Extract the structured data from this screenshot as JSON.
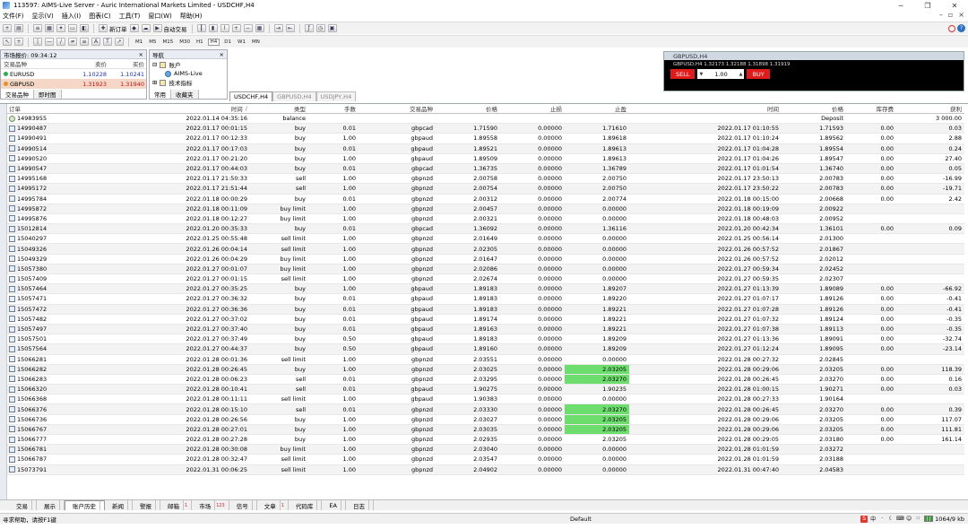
{
  "window": {
    "title": "113597: AIMS-Live Server - Auric International Markets Limited - USDCHF,H4"
  },
  "menu": [
    "文件(F)",
    "显示(V)",
    "插入(I)",
    "图表(C)",
    "工具(T)",
    "窗口(W)",
    "帮助(H)"
  ],
  "toolbar": {
    "new_order": "新订单",
    "auto_trading": "自动交易",
    "timeframes": [
      "M1",
      "M5",
      "M15",
      "M30",
      "H1",
      "H4",
      "D1",
      "W1",
      "MN"
    ]
  },
  "market_watch": {
    "title": "市场报价: 09:34:12",
    "headers": {
      "symbol": "交易品种",
      "bid": "卖价",
      "ask": "买价"
    },
    "rows": [
      {
        "symbol": "EURUSD",
        "bid": "1.10228",
        "ask": "1.10241",
        "color": "#1a2fcf"
      },
      {
        "symbol": "GBPUSD",
        "bid": "1.31923",
        "ask": "1.31940",
        "color": "#cc1010"
      }
    ],
    "tabs": [
      "交易品种",
      "即时图"
    ]
  },
  "navigator": {
    "title": "导航",
    "items": [
      "账户",
      "AIMS-Live",
      "技术指标"
    ],
    "tabs": [
      "常用",
      "收藏夹"
    ]
  },
  "chart_window": {
    "title": "GBPUSD,H4",
    "info": "GBPUSD,H4  1.32173 1.32188 1.31898 1.31919",
    "sell": "SELL",
    "buy": "BUY",
    "lot": "1.00"
  },
  "chart_tabs": [
    "USDCHF,H4",
    "GBPUSD,H4",
    "USDJPY,H4"
  ],
  "history": {
    "headers": {
      "order": "订单",
      "time": "时间",
      "type": "类型",
      "size": "手数",
      "symbol": "交易品种",
      "price": "价格",
      "sl": "止损",
      "tp": "止盈",
      "ctime": "时间",
      "cprice": "价格",
      "swap": "库存费",
      "profit": "获利"
    },
    "rows": [
      {
        "order": "14983955",
        "time": "2022.01.14 04:35:16",
        "type": "balance",
        "size": "",
        "symbol": "",
        "price": "",
        "sl": "",
        "tp": "",
        "ctime": "",
        "cprice": "Deposit",
        "swap": "",
        "profit": "3 000.00",
        "tp_hit": false,
        "balance": true
      },
      {
        "order": "14990487",
        "time": "2022.01.17 00:01:15",
        "type": "buy",
        "size": "0.01",
        "symbol": "gbpcad",
        "price": "1.71590",
        "sl": "0.00000",
        "tp": "1.71610",
        "ctime": "2022.01.17 01:10:55",
        "cprice": "1.71593",
        "swap": "0.00",
        "profit": "0.03",
        "tp_hit": false
      },
      {
        "order": "14990491",
        "time": "2022.01.17 00:12:33",
        "type": "buy",
        "size": "1.00",
        "symbol": "gbpaud",
        "price": "1.89558",
        "sl": "0.00000",
        "tp": "1.89618",
        "ctime": "2022.01.17 01:10:24",
        "cprice": "1.89562",
        "swap": "0.00",
        "profit": "2.88",
        "tp_hit": false
      },
      {
        "order": "14990514",
        "time": "2022.01.17 00:17:03",
        "type": "buy",
        "size": "0.01",
        "symbol": "gbpaud",
        "price": "1.89521",
        "sl": "0.00000",
        "tp": "1.89613",
        "ctime": "2022.01.17 01:04:28",
        "cprice": "1.89554",
        "swap": "0.00",
        "profit": "0.24",
        "tp_hit": false
      },
      {
        "order": "14990520",
        "time": "2022.01.17 00:21:20",
        "type": "buy",
        "size": "1.00",
        "symbol": "gbpaud",
        "price": "1.89509",
        "sl": "0.00000",
        "tp": "1.89613",
        "ctime": "2022.01.17 01:04:26",
        "cprice": "1.89547",
        "swap": "0.00",
        "profit": "27.40",
        "tp_hit": false
      },
      {
        "order": "14990547",
        "time": "2022.01.17 00:44:03",
        "type": "buy",
        "size": "0.01",
        "symbol": "gbpcad",
        "price": "1.36735",
        "sl": "0.00000",
        "tp": "1.36789",
        "ctime": "2022.01.17 01:01:54",
        "cprice": "1.36740",
        "swap": "0.00",
        "profit": "0.05",
        "tp_hit": false
      },
      {
        "order": "14995168",
        "time": "2022.01.17 21:50:33",
        "type": "sell",
        "size": "1.00",
        "symbol": "gbpnzd",
        "price": "2.00758",
        "sl": "0.00000",
        "tp": "2.00750",
        "ctime": "2022.01.17 23:50:13",
        "cprice": "2.00783",
        "swap": "0.00",
        "profit": "-16.99",
        "tp_hit": false
      },
      {
        "order": "14995172",
        "time": "2022.01.17 21:51:44",
        "type": "sell",
        "size": "1.00",
        "symbol": "gbpnzd",
        "price": "2.00754",
        "sl": "0.00000",
        "tp": "2.00750",
        "ctime": "2022.01.17 23:50:22",
        "cprice": "2.00783",
        "swap": "0.00",
        "profit": "-19.71",
        "tp_hit": false
      },
      {
        "order": "14995784",
        "time": "2022.01.18 00:00:29",
        "type": "buy",
        "size": "0.01",
        "symbol": "gbpnzd",
        "price": "2.00312",
        "sl": "0.00000",
        "tp": "2.00774",
        "ctime": "2022.01.18 00:15:00",
        "cprice": "2.00668",
        "swap": "0.00",
        "profit": "2.42",
        "tp_hit": false
      },
      {
        "order": "14995872",
        "time": "2022.01.18 00:11:09",
        "type": "buy limit",
        "size": "1.00",
        "symbol": "gbpnzd",
        "price": "2.00457",
        "sl": "0.00000",
        "tp": "0.00000",
        "ctime": "2022.01.18 00:19:09",
        "cprice": "2.00922",
        "swap": "",
        "profit": "",
        "tp_hit": false
      },
      {
        "order": "14995876",
        "time": "2022.01.18 00:12:27",
        "type": "buy limit",
        "size": "1.00",
        "symbol": "gbpnzd",
        "price": "2.00321",
        "sl": "0.00000",
        "tp": "0.00000",
        "ctime": "2022.01.18 00:48:03",
        "cprice": "2.00952",
        "swap": "",
        "profit": "",
        "tp_hit": false
      },
      {
        "order": "15012814",
        "time": "2022.01.20 00:35:33",
        "type": "buy",
        "size": "0.01",
        "symbol": "gbpcad",
        "price": "1.36092",
        "sl": "0.00000",
        "tp": "1.36116",
        "ctime": "2022.01.20 00:42:34",
        "cprice": "1.36101",
        "swap": "0.00",
        "profit": "0.09",
        "tp_hit": false
      },
      {
        "order": "15040297",
        "time": "2022.01.25 00:55:48",
        "type": "sell limit",
        "size": "1.00",
        "symbol": "gbpnzd",
        "price": "2.01649",
        "sl": "0.00000",
        "tp": "0.00000",
        "ctime": "2022.01.25 00:56:14",
        "cprice": "2.01300",
        "swap": "",
        "profit": "",
        "tp_hit": false
      },
      {
        "order": "15049326",
        "time": "2022.01.26 00:04:14",
        "type": "sell limit",
        "size": "1.00",
        "symbol": "gbpnzd",
        "price": "2.02305",
        "sl": "0.00000",
        "tp": "0.00000",
        "ctime": "2022.01.26 00:57:52",
        "cprice": "2.01867",
        "swap": "",
        "profit": "",
        "tp_hit": false
      },
      {
        "order": "15049329",
        "time": "2022.01.26 00:04:29",
        "type": "buy limit",
        "size": "1.00",
        "symbol": "gbpnzd",
        "price": "2.01647",
        "sl": "0.00000",
        "tp": "0.00000",
        "ctime": "2022.01.26 00:57:52",
        "cprice": "2.02012",
        "swap": "",
        "profit": "",
        "tp_hit": false
      },
      {
        "order": "15057380",
        "time": "2022.01.27 00:01:07",
        "type": "buy limit",
        "size": "1.00",
        "symbol": "gbpnzd",
        "price": "2.02086",
        "sl": "0.00000",
        "tp": "0.00000",
        "ctime": "2022.01.27 00:59:34",
        "cprice": "2.02452",
        "swap": "",
        "profit": "",
        "tp_hit": false
      },
      {
        "order": "15057409",
        "time": "2022.01.27 00:01:15",
        "type": "sell limit",
        "size": "1.00",
        "symbol": "gbpnzd",
        "price": "2.02674",
        "sl": "0.00000",
        "tp": "0.00000",
        "ctime": "2022.01.27 00:59:35",
        "cprice": "2.02307",
        "swap": "",
        "profit": "",
        "tp_hit": false
      },
      {
        "order": "15057464",
        "time": "2022.01.27 00:35:25",
        "type": "buy",
        "size": "1.00",
        "symbol": "gbpaud",
        "price": "1.89183",
        "sl": "0.00000",
        "tp": "1.89207",
        "ctime": "2022.01.27 01:13:39",
        "cprice": "1.89089",
        "swap": "0.00",
        "profit": "-66.92",
        "tp_hit": false
      },
      {
        "order": "15057471",
        "time": "2022.01.27 00:36:32",
        "type": "buy",
        "size": "0.01",
        "symbol": "gbpaud",
        "price": "1.89183",
        "sl": "0.00000",
        "tp": "1.89220",
        "ctime": "2022.01.27 01:07:17",
        "cprice": "1.89126",
        "swap": "0.00",
        "profit": "-0.41",
        "tp_hit": false
      },
      {
        "order": "15057472",
        "time": "2022.01.27 00:36:36",
        "type": "buy",
        "size": "0.01",
        "symbol": "gbpaud",
        "price": "1.89183",
        "sl": "0.00000",
        "tp": "1.89221",
        "ctime": "2022.01.27 01:07:28",
        "cprice": "1.89126",
        "swap": "0.00",
        "profit": "-0.41",
        "tp_hit": false
      },
      {
        "order": "15057482",
        "time": "2022.01.27 00:37:02",
        "type": "buy",
        "size": "0.01",
        "symbol": "gbpaud",
        "price": "1.89174",
        "sl": "0.00000",
        "tp": "1.89221",
        "ctime": "2022.01.27 01:07:32",
        "cprice": "1.89124",
        "swap": "0.00",
        "profit": "-0.35",
        "tp_hit": false
      },
      {
        "order": "15057497",
        "time": "2022.01.27 00:37:40",
        "type": "buy",
        "size": "0.01",
        "symbol": "gbpaud",
        "price": "1.89163",
        "sl": "0.00000",
        "tp": "1.89221",
        "ctime": "2022.01.27 01:07:38",
        "cprice": "1.89113",
        "swap": "0.00",
        "profit": "-0.35",
        "tp_hit": false
      },
      {
        "order": "15057501",
        "time": "2022.01.27 00:37:49",
        "type": "buy",
        "size": "0.50",
        "symbol": "gbpaud",
        "price": "1.89183",
        "sl": "0.00000",
        "tp": "1.89209",
        "ctime": "2022.01.27 01:13:36",
        "cprice": "1.89091",
        "swap": "0.00",
        "profit": "-32.74",
        "tp_hit": false
      },
      {
        "order": "15057564",
        "time": "2022.01.27 00:44:37",
        "type": "buy",
        "size": "0.50",
        "symbol": "gbpaud",
        "price": "1.89160",
        "sl": "0.00000",
        "tp": "1.89209",
        "ctime": "2022.01.27 01:12:24",
        "cprice": "1.89095",
        "swap": "0.00",
        "profit": "-23.14",
        "tp_hit": false
      },
      {
        "order": "15066281",
        "time": "2022.01.28 00:01:36",
        "type": "sell limit",
        "size": "1.00",
        "symbol": "gbpnzd",
        "price": "2.03551",
        "sl": "0.00000",
        "tp": "0.00000",
        "ctime": "2022.01.28 00:27:32",
        "cprice": "2.02845",
        "swap": "",
        "profit": "",
        "tp_hit": false
      },
      {
        "order": "15066282",
        "time": "2022.01.28 00:26:45",
        "type": "buy",
        "size": "1.00",
        "symbol": "gbpnzd",
        "price": "2.03025",
        "sl": "0.00000",
        "tp": "2.03205",
        "ctime": "2022.01.28 00:29:06",
        "cprice": "2.03205",
        "swap": "0.00",
        "profit": "118.39",
        "tp_hit": true
      },
      {
        "order": "15066283",
        "time": "2022.01.28 00:06:23",
        "type": "sell",
        "size": "0.01",
        "symbol": "gbpnzd",
        "price": "2.03295",
        "sl": "0.00000",
        "tp": "2.03270",
        "ctime": "2022.01.28 00:26:45",
        "cprice": "2.03270",
        "swap": "0.00",
        "profit": "0.16",
        "tp_hit": true
      },
      {
        "order": "15066320",
        "time": "2022.01.28 00:10:41",
        "type": "sell",
        "size": "0.01",
        "symbol": "gbpaud",
        "price": "1.90275",
        "sl": "0.00000",
        "tp": "1.90235",
        "ctime": "2022.01.28 01:00:15",
        "cprice": "1.90271",
        "swap": "0.00",
        "profit": "0.03",
        "tp_hit": false
      },
      {
        "order": "15066368",
        "time": "2022.01.28 00:11:11",
        "type": "sell limit",
        "size": "1.00",
        "symbol": "gbpaud",
        "price": "1.90383",
        "sl": "0.00000",
        "tp": "0.00000",
        "ctime": "2022.01.28 00:27:33",
        "cprice": "1.90164",
        "swap": "",
        "profit": "",
        "tp_hit": false
      },
      {
        "order": "15066376",
        "time": "2022.01.28 00:15:10",
        "type": "sell",
        "size": "0.01",
        "symbol": "gbpnzd",
        "price": "2.03330",
        "sl": "0.00000",
        "tp": "2.03270",
        "ctime": "2022.01.28 00:26:45",
        "cprice": "2.03270",
        "swap": "0.00",
        "profit": "0.39",
        "tp_hit": true
      },
      {
        "order": "15066736",
        "time": "2022.01.28 00:26:56",
        "type": "buy",
        "size": "1.00",
        "symbol": "gbpnzd",
        "price": "2.03027",
        "sl": "0.00000",
        "tp": "2.03205",
        "ctime": "2022.01.28 00:29:06",
        "cprice": "2.03205",
        "swap": "0.00",
        "profit": "117.07",
        "tp_hit": true
      },
      {
        "order": "15066767",
        "time": "2022.01.28 00:27:01",
        "type": "buy",
        "size": "1.00",
        "symbol": "gbpnzd",
        "price": "2.03035",
        "sl": "0.00000",
        "tp": "2.03205",
        "ctime": "2022.01.28 00:29:06",
        "cprice": "2.03205",
        "swap": "0.00",
        "profit": "111.81",
        "tp_hit": true
      },
      {
        "order": "15066777",
        "time": "2022.01.28 00:27:28",
        "type": "buy",
        "size": "1.00",
        "symbol": "gbpnzd",
        "price": "2.02935",
        "sl": "0.00000",
        "tp": "2.03205",
        "ctime": "2022.01.28 00:29:05",
        "cprice": "2.03180",
        "swap": "0.00",
        "profit": "161.14",
        "tp_hit": false
      },
      {
        "order": "15066781",
        "time": "2022.01.28 00:30:08",
        "type": "buy limit",
        "size": "1.00",
        "symbol": "gbpnzd",
        "price": "2.03040",
        "sl": "0.00000",
        "tp": "0.00000",
        "ctime": "2022.01.28 01:01:59",
        "cprice": "2.03272",
        "swap": "",
        "profit": "",
        "tp_hit": false
      },
      {
        "order": "15066787",
        "time": "2022.01.28 00:32:47",
        "type": "sell limit",
        "size": "1.00",
        "symbol": "gbpnzd",
        "price": "2.03547",
        "sl": "0.00000",
        "tp": "0.00000",
        "ctime": "2022.01.28 01:01:59",
        "cprice": "2.03188",
        "swap": "",
        "profit": "",
        "tp_hit": false
      },
      {
        "order": "15073791",
        "time": "2022.01.31 00:06:25",
        "type": "sell limit",
        "size": "1.00",
        "symbol": "gbpnzd",
        "price": "2.04902",
        "sl": "0.00000",
        "tp": "0.00000",
        "ctime": "2022.01.31 00:47:40",
        "cprice": "2.04583",
        "swap": "",
        "profit": "",
        "tp_hit": false
      }
    ]
  },
  "bottom_tabs": [
    {
      "label": "交易",
      "badge": ""
    },
    {
      "label": "展示",
      "badge": ""
    },
    {
      "label": "账户历史",
      "badge": "",
      "active": true
    },
    {
      "label": "新闻",
      "badge": ""
    },
    {
      "label": "警报",
      "badge": ""
    },
    {
      "label": "邮箱",
      "badge": "1"
    },
    {
      "label": "市场",
      "badge": "123"
    },
    {
      "label": "信号",
      "badge": ""
    },
    {
      "label": "文章",
      "badge": "1"
    },
    {
      "label": "代码库",
      "badge": ""
    },
    {
      "label": "EA",
      "badge": ""
    },
    {
      "label": "日志",
      "badge": ""
    }
  ],
  "status": {
    "help": "寻求帮助，请按F1键",
    "profile": "Default",
    "traffic": "1064/9 kb"
  }
}
